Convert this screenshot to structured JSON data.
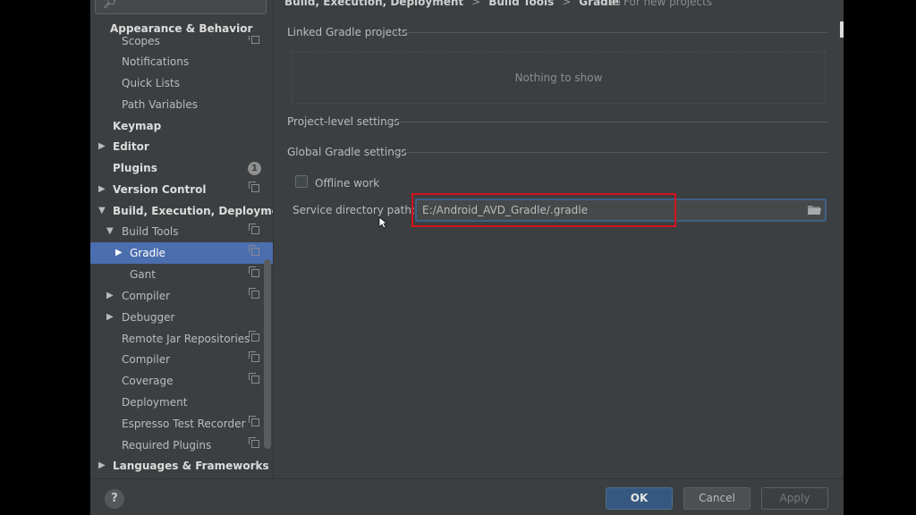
{
  "sidebar": {
    "search_icon": "magnifier-icon",
    "section_header": "Appearance & Behavior",
    "items": [
      {
        "label": "Scopes"
      },
      {
        "label": "Notifications"
      },
      {
        "label": "Quick Lists"
      },
      {
        "label": "Path Variables"
      },
      {
        "label": "Keymap"
      },
      {
        "label": "Editor"
      },
      {
        "label": "Plugins",
        "badge": "1"
      },
      {
        "label": "Version Control"
      },
      {
        "label": "Build, Execution, Deployment"
      },
      {
        "label": "Build Tools"
      },
      {
        "label": "Gradle"
      },
      {
        "label": "Gant"
      },
      {
        "label": "Compiler"
      },
      {
        "label": "Debugger"
      },
      {
        "label": "Remote Jar Repositories"
      },
      {
        "label": "Compiler"
      },
      {
        "label": "Coverage"
      },
      {
        "label": "Deployment"
      },
      {
        "label": "Espresso Test Recorder"
      },
      {
        "label": "Required Plugins"
      },
      {
        "label": "Languages & Frameworks"
      }
    ]
  },
  "breadcrumb": {
    "parts": [
      "Build, Execution, Deployment",
      "Build Tools",
      "Gradle"
    ],
    "separator": ">",
    "for_new_projects": "For new projects"
  },
  "content": {
    "linked_title": "Linked Gradle projects",
    "nothing_to_show": "Nothing to show",
    "project_level_title": "Project-level settings",
    "global_title": "Global Gradle settings",
    "offline_label": "Offline work",
    "offline_checked": false,
    "service_label": "Service directory path:",
    "service_value": "E:/Android_AVD_Gradle/.gradle"
  },
  "buttons": {
    "help": "?",
    "ok": "OK",
    "cancel": "Cancel",
    "apply": "Apply"
  },
  "colors": {
    "selection": "#4b6eaf",
    "highlight": "#d5121c",
    "ok_button": "#365880"
  }
}
